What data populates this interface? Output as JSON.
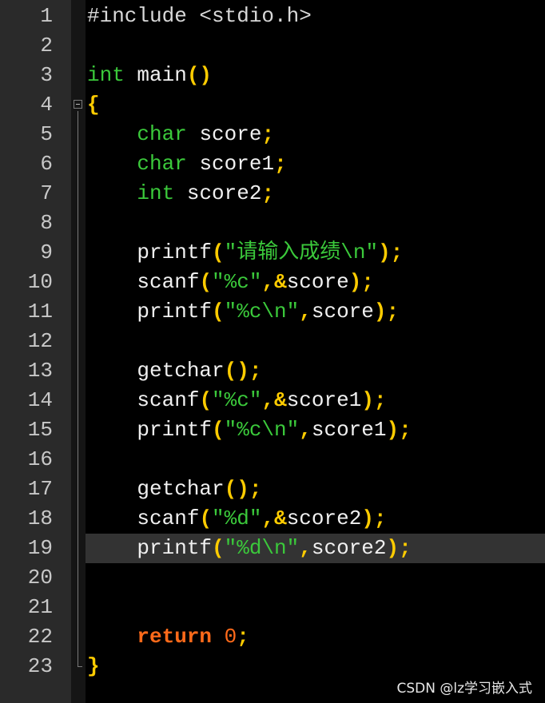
{
  "editor": {
    "current_line": 19,
    "lines": [
      {
        "number": "1",
        "tokens": [
          {
            "t": "#include <stdio.h>",
            "c": "pre"
          }
        ]
      },
      {
        "number": "2",
        "tokens": []
      },
      {
        "number": "3",
        "tokens": [
          {
            "t": "int",
            "c": "kw"
          },
          {
            "t": " main",
            "c": "plain"
          },
          {
            "t": "()",
            "c": "op"
          }
        ]
      },
      {
        "number": "4",
        "tokens": [
          {
            "t": "{",
            "c": "op"
          }
        ]
      },
      {
        "number": "5",
        "tokens": [
          {
            "t": "    ",
            "c": "plain"
          },
          {
            "t": "char",
            "c": "kw"
          },
          {
            "t": " score",
            "c": "plain"
          },
          {
            "t": ";",
            "c": "op"
          }
        ]
      },
      {
        "number": "6",
        "tokens": [
          {
            "t": "    ",
            "c": "plain"
          },
          {
            "t": "char",
            "c": "kw"
          },
          {
            "t": " score1",
            "c": "plain"
          },
          {
            "t": ";",
            "c": "op"
          }
        ]
      },
      {
        "number": "7",
        "tokens": [
          {
            "t": "    ",
            "c": "plain"
          },
          {
            "t": "int",
            "c": "kw"
          },
          {
            "t": " score2",
            "c": "plain"
          },
          {
            "t": ";",
            "c": "op"
          }
        ]
      },
      {
        "number": "8",
        "tokens": []
      },
      {
        "number": "9",
        "tokens": [
          {
            "t": "    printf",
            "c": "plain"
          },
          {
            "t": "(",
            "c": "op"
          },
          {
            "t": "\"请输入成绩\\n\"",
            "c": "str"
          },
          {
            "t": ");",
            "c": "op"
          }
        ]
      },
      {
        "number": "10",
        "tokens": [
          {
            "t": "    scanf",
            "c": "plain"
          },
          {
            "t": "(",
            "c": "op"
          },
          {
            "t": "\"%c\"",
            "c": "str"
          },
          {
            "t": ",&",
            "c": "op"
          },
          {
            "t": "score",
            "c": "plain"
          },
          {
            "t": ");",
            "c": "op"
          }
        ]
      },
      {
        "number": "11",
        "tokens": [
          {
            "t": "    printf",
            "c": "plain"
          },
          {
            "t": "(",
            "c": "op"
          },
          {
            "t": "\"%c\\n\"",
            "c": "str"
          },
          {
            "t": ",",
            "c": "op"
          },
          {
            "t": "score",
            "c": "plain"
          },
          {
            "t": ");",
            "c": "op"
          }
        ]
      },
      {
        "number": "12",
        "tokens": []
      },
      {
        "number": "13",
        "tokens": [
          {
            "t": "    getchar",
            "c": "plain"
          },
          {
            "t": "();",
            "c": "op"
          }
        ]
      },
      {
        "number": "14",
        "tokens": [
          {
            "t": "    scanf",
            "c": "plain"
          },
          {
            "t": "(",
            "c": "op"
          },
          {
            "t": "\"%c\"",
            "c": "str"
          },
          {
            "t": ",&",
            "c": "op"
          },
          {
            "t": "score1",
            "c": "plain"
          },
          {
            "t": ");",
            "c": "op"
          }
        ]
      },
      {
        "number": "15",
        "tokens": [
          {
            "t": "    printf",
            "c": "plain"
          },
          {
            "t": "(",
            "c": "op"
          },
          {
            "t": "\"%c\\n\"",
            "c": "str"
          },
          {
            "t": ",",
            "c": "op"
          },
          {
            "t": "score1",
            "c": "plain"
          },
          {
            "t": ");",
            "c": "op"
          }
        ]
      },
      {
        "number": "16",
        "tokens": []
      },
      {
        "number": "17",
        "tokens": [
          {
            "t": "    getchar",
            "c": "plain"
          },
          {
            "t": "();",
            "c": "op"
          }
        ]
      },
      {
        "number": "18",
        "tokens": [
          {
            "t": "    scanf",
            "c": "plain"
          },
          {
            "t": "(",
            "c": "op"
          },
          {
            "t": "\"%d\"",
            "c": "str"
          },
          {
            "t": ",&",
            "c": "op"
          },
          {
            "t": "score2",
            "c": "plain"
          },
          {
            "t": ");",
            "c": "op"
          }
        ]
      },
      {
        "number": "19",
        "tokens": [
          {
            "t": "    printf",
            "c": "plain"
          },
          {
            "t": "(",
            "c": "op"
          },
          {
            "t": "\"%d\\n\"",
            "c": "str"
          },
          {
            "t": ",",
            "c": "op"
          },
          {
            "t": "score2",
            "c": "plain"
          },
          {
            "t": ");",
            "c": "op"
          }
        ]
      },
      {
        "number": "20",
        "tokens": []
      },
      {
        "number": "21",
        "tokens": []
      },
      {
        "number": "22",
        "tokens": [
          {
            "t": "    ",
            "c": "plain"
          },
          {
            "t": "return",
            "c": "ret"
          },
          {
            "t": " ",
            "c": "plain"
          },
          {
            "t": "0",
            "c": "num"
          },
          {
            "t": ";",
            "c": "op"
          }
        ]
      },
      {
        "number": "23",
        "tokens": [
          {
            "t": "}",
            "c": "op"
          }
        ]
      }
    ]
  },
  "colors": {
    "background": "#000000",
    "gutter": "#2a2a2a",
    "keyword": "#3bc93b",
    "string": "#3bc93b",
    "operator": "#ffcc00",
    "return_keyword": "#ff6a1a",
    "number": "#ff6a1a",
    "current_line": "#333333"
  },
  "fold_icon": "fold-minus-icon",
  "watermark": "CSDN @lz学习嵌入式"
}
